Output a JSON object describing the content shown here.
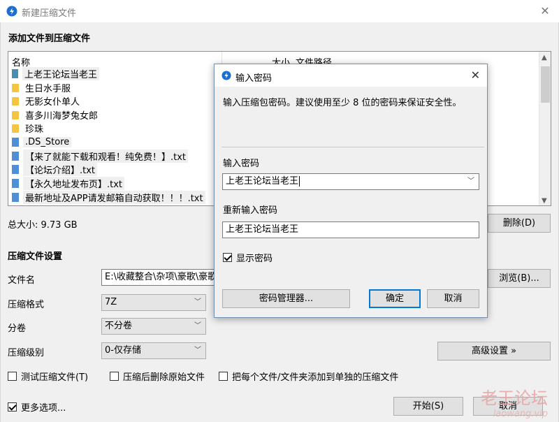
{
  "window": {
    "title": "新建压缩文件"
  },
  "add_section": {
    "title": "添加文件到压缩文件"
  },
  "filelist": {
    "columns": {
      "name": "名称",
      "size": "大小",
      "path": "文件路径"
    },
    "items": [
      {
        "type": "archive",
        "name": "上老王论坛当老王"
      },
      {
        "type": "folder",
        "name": "生日水手服"
      },
      {
        "type": "folder",
        "name": "无影女仆单人"
      },
      {
        "type": "folder",
        "name": "喜多川海梦兔女郎"
      },
      {
        "type": "folder",
        "name": "珍珠"
      },
      {
        "type": "file",
        "name": ".DS_Store"
      },
      {
        "type": "file",
        "name": "【来了就能下载和观看！纯免费！】.txt"
      },
      {
        "type": "file",
        "name": "【论坛介绍】.txt"
      },
      {
        "type": "file",
        "name": "【永久地址发布页】.txt"
      },
      {
        "type": "file",
        "name": "最新地址及APP请发邮箱自动获取！！！.txt"
      }
    ]
  },
  "total_size": "总大小: 9.73 GB",
  "delete_button": "删除(D)",
  "settings": {
    "title": "压缩文件设置",
    "filename_label": "文件名",
    "filename_value": "E:\\收藏整合\\杂项\\豪歌\\豪歌",
    "browse_button": "浏览(B)...",
    "format_label": "压缩格式",
    "format_value": "7Z",
    "split_label": "分卷",
    "split_value": "不分卷",
    "level_label": "压缩级别",
    "level_value": "0-仅存储",
    "advanced_button": "高级设置 »"
  },
  "options": {
    "test": "测试压缩文件(T)",
    "delete_after": "压缩后删除原始文件",
    "separate": "把每个文件/文件夹添加到单独的压缩文件",
    "more": "更多选项..."
  },
  "footer": {
    "start": "开始(S)",
    "cancel": "取消"
  },
  "watermark": {
    "text": "老王论坛",
    "url": "laowang.vip"
  },
  "dialog": {
    "title": "输入密码",
    "description": "输入压缩包密码。建议使用至少 8 位的密码来保证安全性。",
    "password_label": "输入密码",
    "password_value": "上老王论坛当老王",
    "confirm_label": "重新输入密码",
    "confirm_value": "上老王论坛当老王",
    "show_password": "显示密码",
    "manager_button": "密码管理器...",
    "ok_button": "确定",
    "cancel_button": "取消"
  },
  "colors": {
    "accent": "#0078d7",
    "folder": "#f5c542",
    "file": "#4f8fd6"
  }
}
